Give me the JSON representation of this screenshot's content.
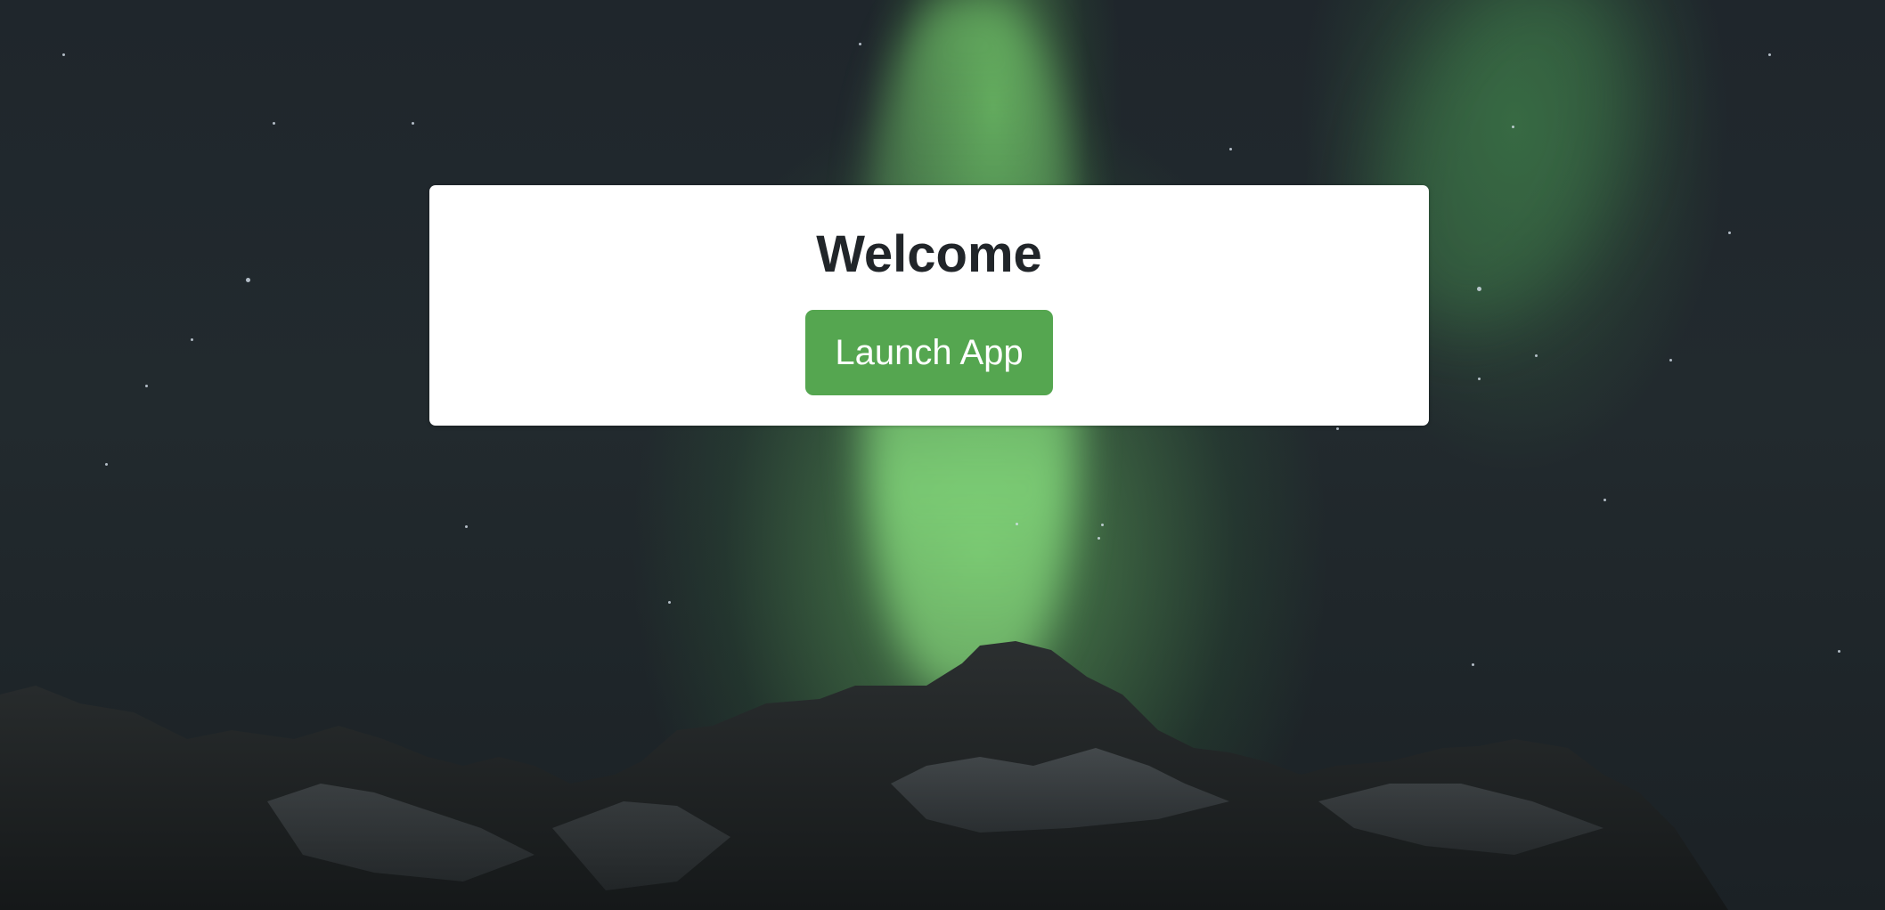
{
  "welcome": {
    "title": "Welcome",
    "launch_button_label": "Launch App"
  },
  "colors": {
    "card_background": "#ffffff",
    "title_text": "#212529",
    "button_background": "#55a650",
    "button_text": "#ffffff",
    "sky": "#1f262c",
    "aurora": "#8fe07f"
  }
}
